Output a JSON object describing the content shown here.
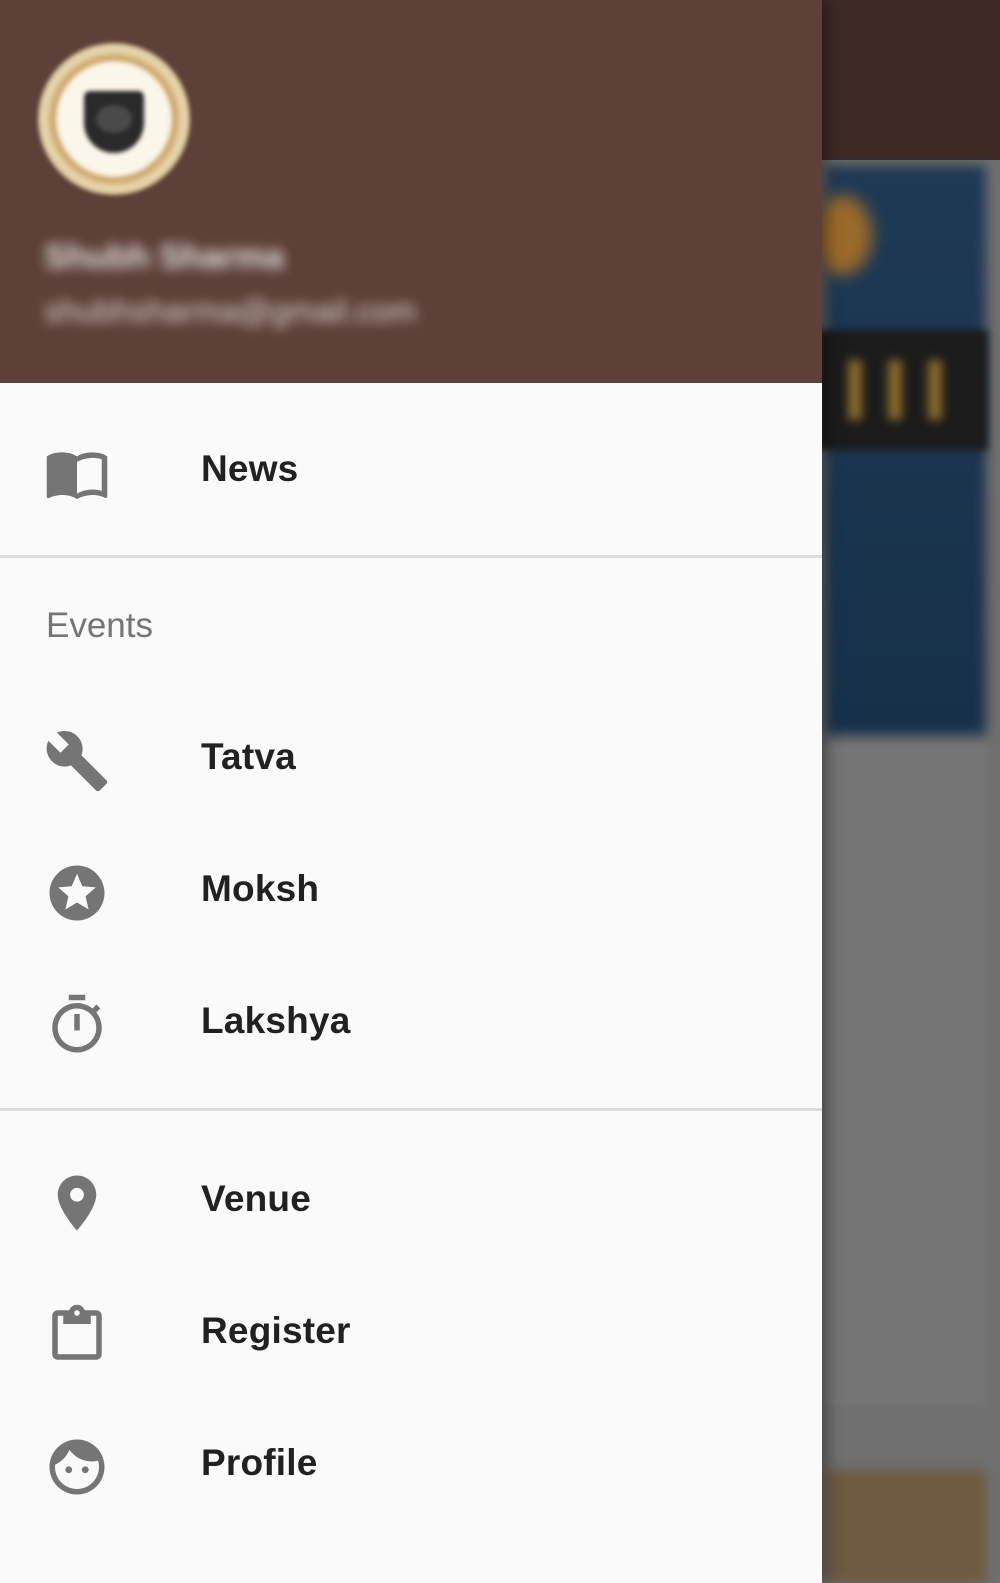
{
  "drawer": {
    "header": {
      "user_name": "Shubh Sharma",
      "user_email": "shubhsharma@gmail.com"
    },
    "items": [
      {
        "label": "News",
        "icon": "book-open-icon"
      },
      {
        "label": "Tatva",
        "icon": "wrench-icon"
      },
      {
        "label": "Moksh",
        "icon": "star-circle-icon"
      },
      {
        "label": "Lakshya",
        "icon": "stopwatch-icon"
      },
      {
        "label": "Venue",
        "icon": "location-pin-icon"
      },
      {
        "label": "Register",
        "icon": "clipboard-icon"
      },
      {
        "label": "Profile",
        "icon": "face-icon"
      }
    ],
    "section_events": "Events"
  },
  "colors": {
    "header_bg": "#5d4037",
    "drawer_bg": "#fafafa",
    "icon": "#757575",
    "text": "#212121"
  }
}
